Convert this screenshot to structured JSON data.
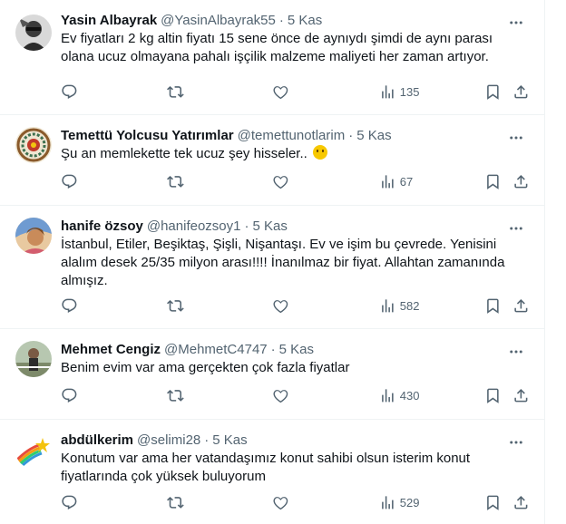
{
  "tweets": [
    {
      "name": "Yasin Albayrak",
      "handle": "@YasinAlbayrak55",
      "separator": "·",
      "time": "5 Kas",
      "text": "Ev fiyatları 2 kg altin fiyatı 15 sene önce de aynıydı şimdi de aynı parası olana ucuz olmayana pahalı işçilik malzeme maliyeti her zaman artıyor.",
      "views": "135",
      "avatar": "avatar-man-sunglasses"
    },
    {
      "name": "Temettü Yolcusu Yatırımlar",
      "handle": "@temettunotlarim",
      "separator": "·",
      "time": "5 Kas",
      "text": "Şu an memlekette tek ucuz şey hisseler..",
      "emoji": "hugging-face-emoji",
      "views": "67",
      "avatar": "avatar-mandala"
    },
    {
      "name": "hanife özsoy",
      "handle": "@hanifeozsoy1",
      "separator": "·",
      "time": "5 Kas",
      "text": "İstanbul, Etiler, Beşiktaş, Şişli, Nişantaşı. Ev ve işim bu çevrede. Yenisini alalım desek 25/35 milyon arası!!!! İnanılmaz bir fiyat. Allahtan zamanında almışız.",
      "views": "582",
      "avatar": "avatar-woman-photo"
    },
    {
      "name": "Mehmet Cengiz",
      "handle": "@MehmetC4747",
      "separator": "·",
      "time": "5 Kas",
      "text": "Benim evim var ama gerçekten çok fazla fiyatlar",
      "views": "430",
      "avatar": "avatar-man-outdoor"
    },
    {
      "name": "abdülkerim",
      "handle": "@selimi28",
      "separator": "·",
      "time": "5 Kas",
      "text": "Konutum var ama her vatandaşımız konut sahibi olsun isterim konut fiyatlarında çok yüksek buluyorum",
      "views": "529",
      "avatar": "avatar-rainbow-star"
    }
  ],
  "icons": {
    "reply": "reply-icon",
    "retweet": "retweet-icon",
    "like": "like-icon",
    "views": "views-icon",
    "bookmark": "bookmark-icon",
    "share": "share-icon",
    "more": "more-icon"
  },
  "colors": {
    "text": "#0f1419",
    "secondary": "#536471",
    "border": "#eff3f4"
  }
}
